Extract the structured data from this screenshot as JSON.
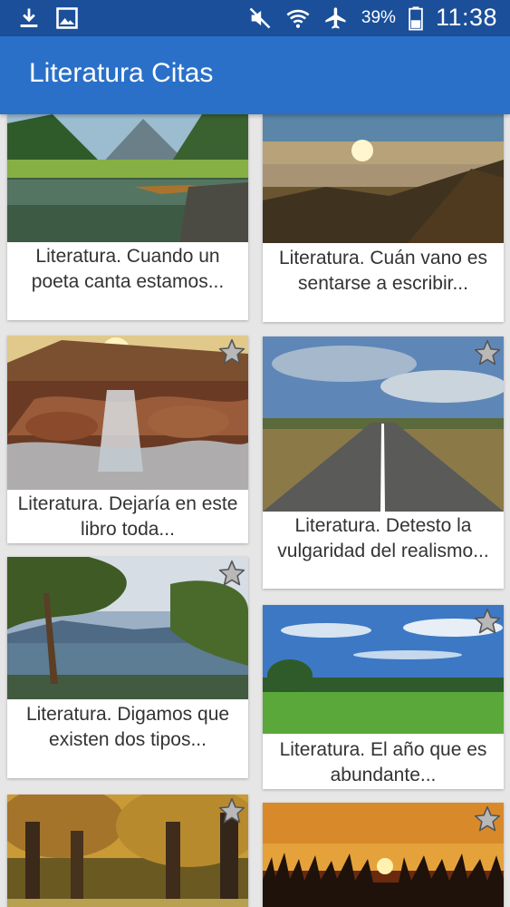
{
  "status_bar": {
    "battery_percent": "39%",
    "time": "11:38",
    "icons": [
      "download-icon",
      "image-icon",
      "mute-icon",
      "wifi-icon",
      "airplane-icon",
      "battery-icon"
    ]
  },
  "app_bar": {
    "title": "Literatura Citas"
  },
  "cards": [
    {
      "caption": "Literatura. Cuando un poeta canta estamos...",
      "scene": "lake-mountains",
      "favorite_icon": "star-icon"
    },
    {
      "caption": "Literatura. Cuán vano es sentarse a escribir...",
      "scene": "sunset-sky",
      "favorite_icon": "star-icon"
    },
    {
      "caption": "Literatura. Dejaría en este libro toda...",
      "scene": "waterfall-rocks",
      "favorite_icon": "star-icon"
    },
    {
      "caption": "Literatura. Detesto la vulgaridad del realismo...",
      "scene": "road-horizon",
      "favorite_icon": "star-icon"
    },
    {
      "caption": "Literatura. Digamos que existen dos tipos...",
      "scene": "lake-tree",
      "favorite_icon": "star-icon"
    },
    {
      "caption": "Literatura. El año que es abundante...",
      "scene": "green-field",
      "favorite_icon": "star-icon"
    },
    {
      "caption": "",
      "scene": "autumn-trees",
      "favorite_icon": "star-icon"
    },
    {
      "caption": "",
      "scene": "sunset-crowd",
      "favorite_icon": "star-icon"
    }
  ]
}
